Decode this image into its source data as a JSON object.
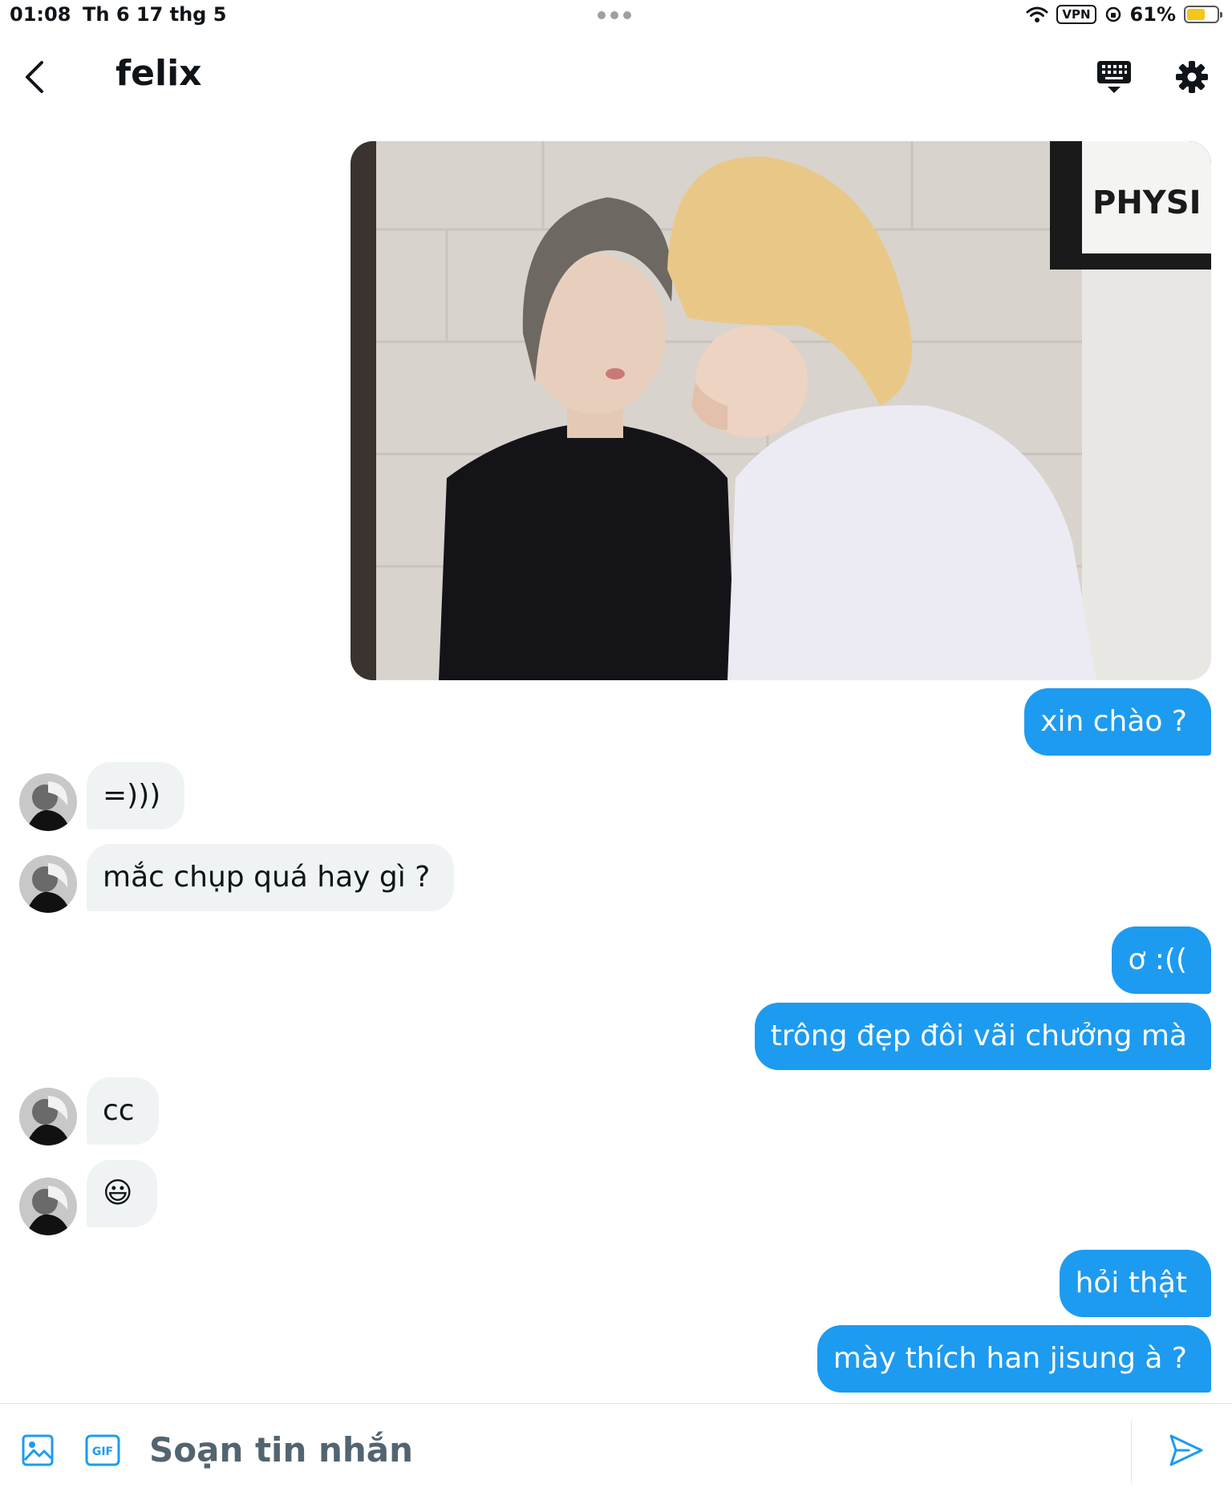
{
  "status_bar": {
    "time": "01:08",
    "date": "Th 6 17 thg 5",
    "vpn": "VPN",
    "battery": "61%",
    "battery_level": 0.61
  },
  "header": {
    "title": "felix"
  },
  "messages": [
    {
      "side": "out",
      "type": "image",
      "image_text": "PHYSI"
    },
    {
      "side": "out",
      "text": "xin chào ?"
    },
    {
      "side": "in",
      "text": "=)))"
    },
    {
      "side": "in",
      "text": "mắc chụp quá hay gì ?"
    },
    {
      "side": "out",
      "text": "ơ :(("
    },
    {
      "side": "out",
      "text": "trông đẹp đôi vãi chưởng mà"
    },
    {
      "side": "in",
      "text": "cc"
    },
    {
      "side": "in",
      "text": "😃"
    },
    {
      "side": "out",
      "text": "hỏi thật"
    },
    {
      "side": "out",
      "text": "mày thích han jisung à ?"
    }
  ],
  "composer": {
    "placeholder": "Soạn tin nhắn",
    "gif_label": "GIF"
  },
  "colors": {
    "accent": "#1d9bf0",
    "incoming_bubble": "#eff3f4",
    "battery": "#f5c518"
  }
}
